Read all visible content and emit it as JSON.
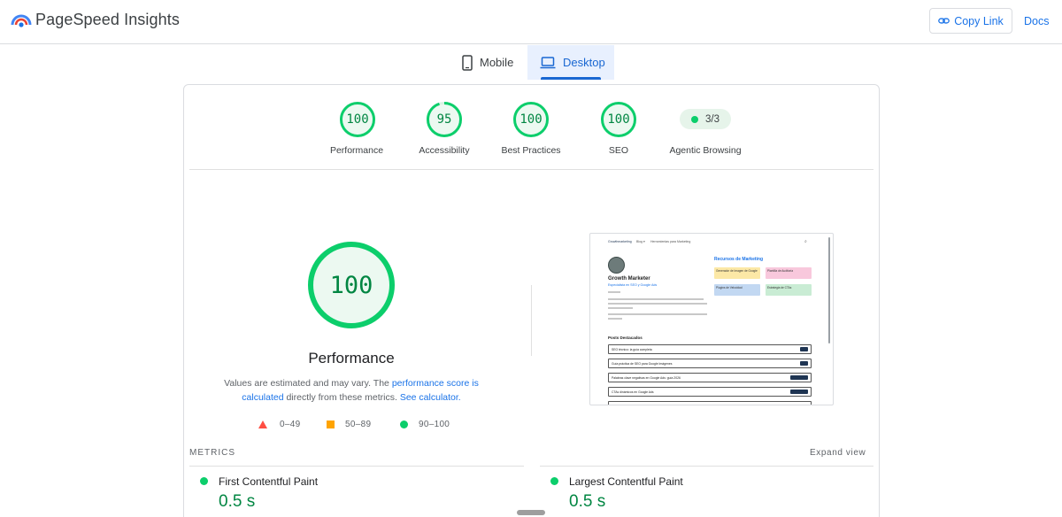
{
  "header": {
    "brand": "PageSpeed Insights",
    "copy_link": "Copy Link",
    "docs": "Docs",
    "accent": "#1a73e8"
  },
  "tabs": [
    {
      "label": "Mobile",
      "icon": "phone-icon",
      "selected": false
    },
    {
      "label": "Desktop",
      "icon": "laptop-icon",
      "selected": true
    }
  ],
  "categories": [
    {
      "label": "Performance",
      "score": "100",
      "fraction": 1.0
    },
    {
      "label": "Accessibility",
      "score": "95",
      "fraction": 0.95
    },
    {
      "label": "Best Practices",
      "score": "100",
      "fraction": 1.0
    },
    {
      "label": "SEO",
      "score": "100",
      "fraction": 1.0
    }
  ],
  "agentic": {
    "value": "3/3",
    "label": "Agentic Browsing"
  },
  "performance": {
    "score": "100",
    "title": "Performance",
    "note_start": "Values are estimated and may vary. The ",
    "note_link1": "performance score is calculated",
    "note_middle": " directly from these metrics. ",
    "note_link2": "See calculator."
  },
  "legend": [
    {
      "range": "0–49",
      "color": "#ff4e42"
    },
    {
      "range": "50–89",
      "color": "#ffa400"
    },
    {
      "range": "90–100",
      "color": "#0cce6b"
    }
  ],
  "screenshot": {
    "nav_brand": "Growthmarketing",
    "nav_blog": "Blog ▾",
    "nav_tools": "Herramientas para Marketing",
    "name": "Growth Marketer",
    "subtitle": "Especialista en SEO y Google Ads",
    "resources_title": "Recursos de Marketing",
    "resources": [
      "Generador de Imagen de Google",
      "Plantilla de Auditoría",
      "Plugins de Velocidad",
      "Estrategia de CTAs"
    ],
    "posts_title": "Posts Destacados",
    "posts": [
      "SEO técnico: la guía completa",
      "Guía práctica de SEO para Google Imágenes",
      "Palabras clave negativas en Google Ads: guía 2026",
      "CTAs dinámicos en Google Ads"
    ]
  },
  "metrics": {
    "label": "METRICS",
    "expand": "Expand view",
    "items": [
      {
        "name": "First Contentful Paint",
        "value": "0.5 s"
      },
      {
        "name": "Largest Contentful Paint",
        "value": "0.5 s"
      }
    ]
  }
}
